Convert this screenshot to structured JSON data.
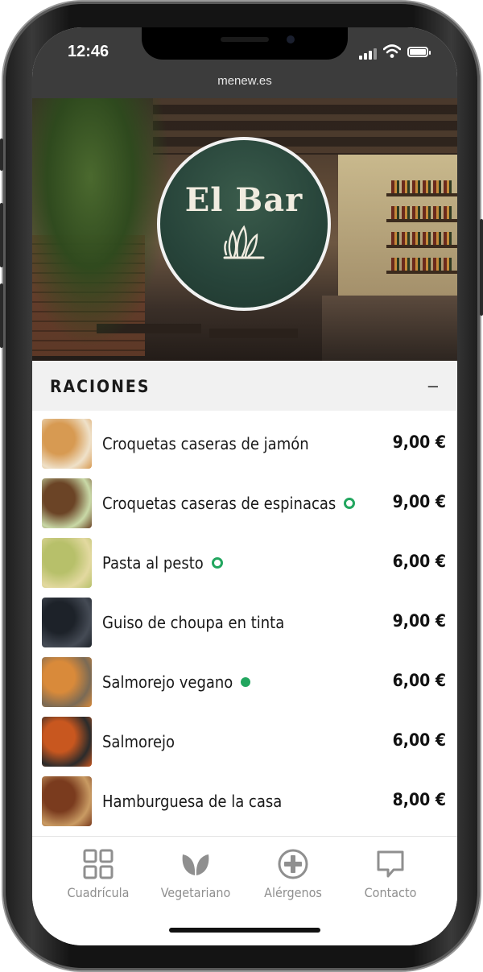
{
  "status_bar": {
    "time": "12:46",
    "url": "menew.es"
  },
  "header": {
    "logo_text": "El Bar",
    "logo_mark": "leaf-sprig-icon"
  },
  "section": {
    "title": "RACIONES",
    "toggle": "–"
  },
  "menu_items": [
    {
      "name": "Croquetas caseras de jamón",
      "price": "9,00 €",
      "badge": null,
      "thumb_colors": [
        "#d79a52",
        "#efe1c9"
      ]
    },
    {
      "name": "Croquetas caseras de espinacas",
      "price": "9,00 €",
      "badge": "vegetarian-outline",
      "thumb_colors": [
        "#6b4426",
        "#c9d9a7"
      ]
    },
    {
      "name": "Pasta al pesto",
      "price": "6,00 €",
      "badge": "vegetarian-outline",
      "thumb_colors": [
        "#b7c06a",
        "#e3d9a0"
      ]
    },
    {
      "name": "Guiso de choupa en tinta",
      "price": "9,00 €",
      "badge": null,
      "thumb_colors": [
        "#1d2229",
        "#454b55"
      ]
    },
    {
      "name": "Salmorejo vegano",
      "price": "6,00 €",
      "badge": "vegan-solid",
      "thumb_colors": [
        "#d98a3a",
        "#7a6a55"
      ]
    },
    {
      "name": "Salmorejo",
      "price": "6,00 €",
      "badge": null,
      "thumb_colors": [
        "#c8571f",
        "#2b2b2b"
      ]
    },
    {
      "name": "Hamburguesa de la casa",
      "price": "8,00 €",
      "badge": null,
      "thumb_colors": [
        "#7a3b1e",
        "#c99b63"
      ]
    }
  ],
  "bottom_nav": [
    {
      "label": "Cuadrícula",
      "icon": "grid-icon"
    },
    {
      "label": "Vegetariano",
      "icon": "leaf-icon"
    },
    {
      "label": "Alérgenos",
      "icon": "plus-circle-icon"
    },
    {
      "label": "Contacto",
      "icon": "chat-bubble-icon"
    }
  ],
  "colors": {
    "brand_green": "#27443a",
    "veg_green": "#22a65f",
    "nav_gray": "#8f8f8f"
  }
}
